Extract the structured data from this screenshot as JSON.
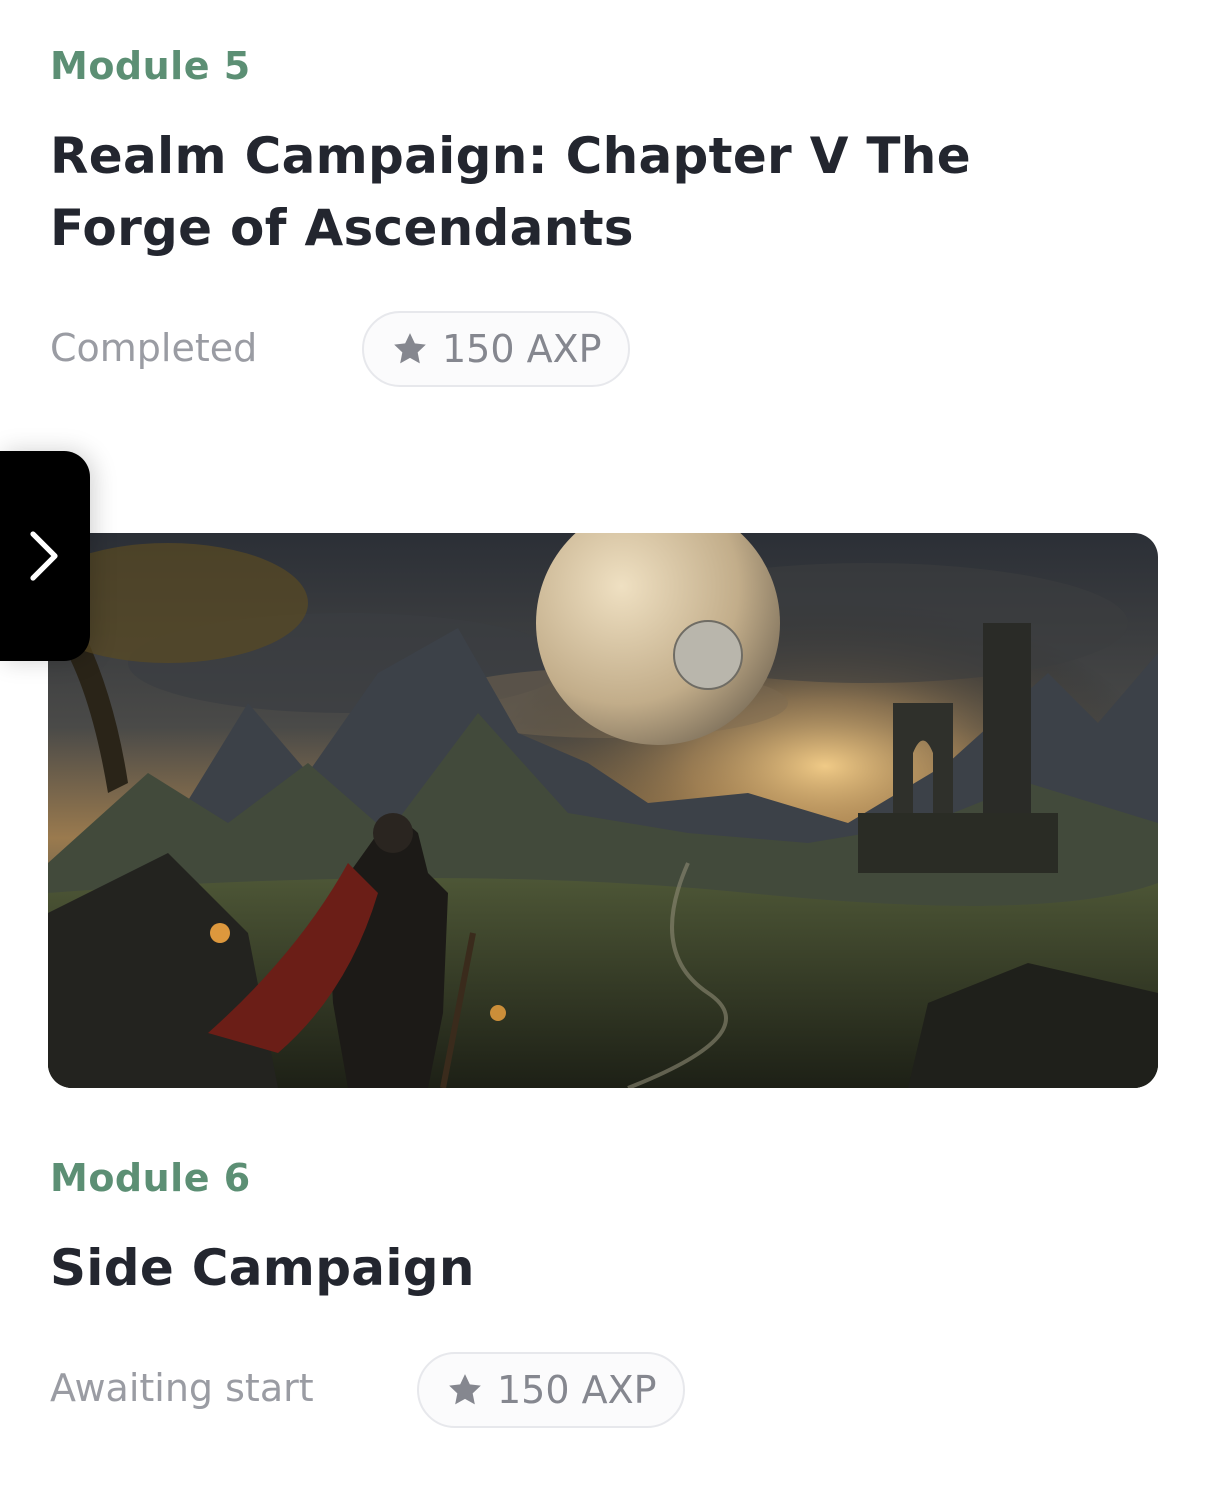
{
  "modules": [
    {
      "label": "Module 5",
      "title": "Realm Campaign: Chapter V The Forge of Ascendants",
      "status": "Completed",
      "reward": "150 AXP",
      "reward_icon": "star-icon"
    },
    {
      "label": "Module 6",
      "title": "Side Campaign",
      "status": "Awaiting start",
      "reward": "150 AXP",
      "reward_icon": "star-icon"
    }
  ],
  "side_tab": {
    "icon": "chevron-right-icon"
  },
  "colors": {
    "module_label": "#5c8f74",
    "title": "#23262f",
    "status": "#9a9ca3",
    "pill_border": "#e7e8ec",
    "side_tab": "#000000"
  }
}
